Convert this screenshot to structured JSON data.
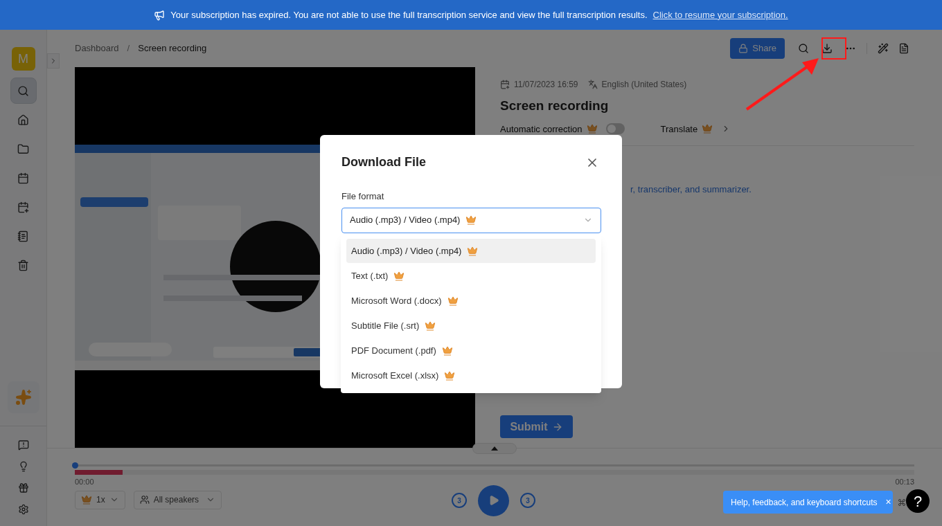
{
  "banner": {
    "text": "Your subscription has expired. You are not able to use the full transcription service and view the full transcription results.",
    "link": "Click to resume your subscription."
  },
  "sidebar": {
    "avatar": "M",
    "items": [
      {
        "kind": "search",
        "selected": true
      },
      {
        "kind": "home",
        "selected": false
      },
      {
        "kind": "folder",
        "selected": false
      },
      {
        "kind": "calendar",
        "selected": false
      },
      {
        "kind": "calendar-add",
        "selected": false
      },
      {
        "kind": "notes",
        "selected": false
      },
      {
        "kind": "trash",
        "selected": false
      }
    ]
  },
  "breadcrumb": {
    "items": [
      "Dashboard",
      "Screen recording"
    ],
    "separator": "/"
  },
  "toolbar": {
    "share": "Share"
  },
  "recording": {
    "date": "11/07/2023 16:59",
    "language": "English (United States)",
    "title": "Screen recording",
    "correction": {
      "label": "Automatic correction",
      "on": false
    },
    "translate": "Translate",
    "fragment": "r, transcriber, and summarizer.",
    "submit": "Submit"
  },
  "player": {
    "elapsed": "00:00",
    "duration": "00:13",
    "level": 0,
    "speed": "1x",
    "speakers": "All speakers",
    "rewind": "3",
    "forward": "3"
  },
  "modal": {
    "title": "Download File",
    "field_label": "File format",
    "value": "Audio (.mp3) / Video (.mp4)",
    "options": [
      {
        "label": "Audio (.mp3) / Video (.mp4)",
        "selected": true
      },
      {
        "label": "Text (.txt)",
        "selected": false
      },
      {
        "label": "Microsoft Word (.docx)",
        "selected": false
      },
      {
        "label": "Subtitle File (.srt)",
        "selected": false
      },
      {
        "label": "PDF Document (.pdf)",
        "selected": false
      },
      {
        "label": "Microsoft Excel (.xlsx)",
        "selected": false
      }
    ]
  },
  "help": {
    "text": "Help, feedback, and keyboard shortcuts",
    "close": "×",
    "button": "?"
  }
}
